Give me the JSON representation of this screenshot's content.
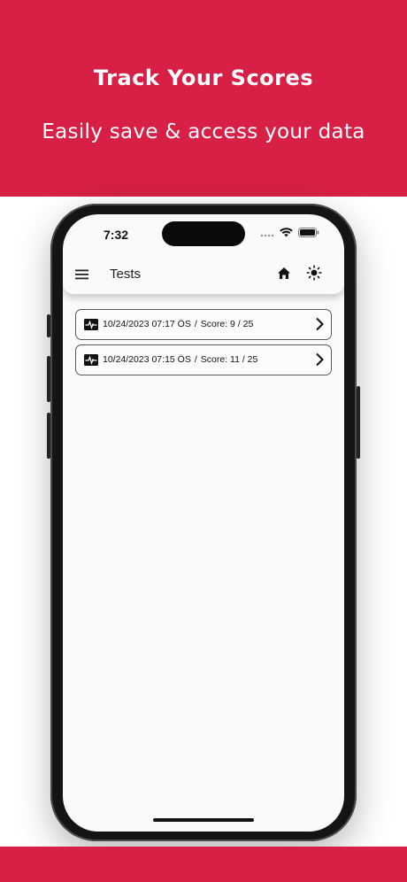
{
  "banner": {
    "title": "Track Your Scores",
    "subtitle": "Easily save & access your data",
    "color": "#d81f45"
  },
  "status_bar": {
    "time": "7:32",
    "icons": [
      "signal-icon",
      "wifi-icon",
      "battery-icon"
    ]
  },
  "header": {
    "title": "Tests",
    "icons": [
      "menu-icon",
      "home-icon",
      "theme-toggle-icon"
    ]
  },
  "tests": [
    {
      "date": "10/24/2023 07:17 ÖS",
      "separator": "/",
      "score": "Score: 9 / 25"
    },
    {
      "date": "10/24/2023 07:15 ÖS",
      "separator": "/",
      "score": "Score: 11 / 25"
    }
  ]
}
